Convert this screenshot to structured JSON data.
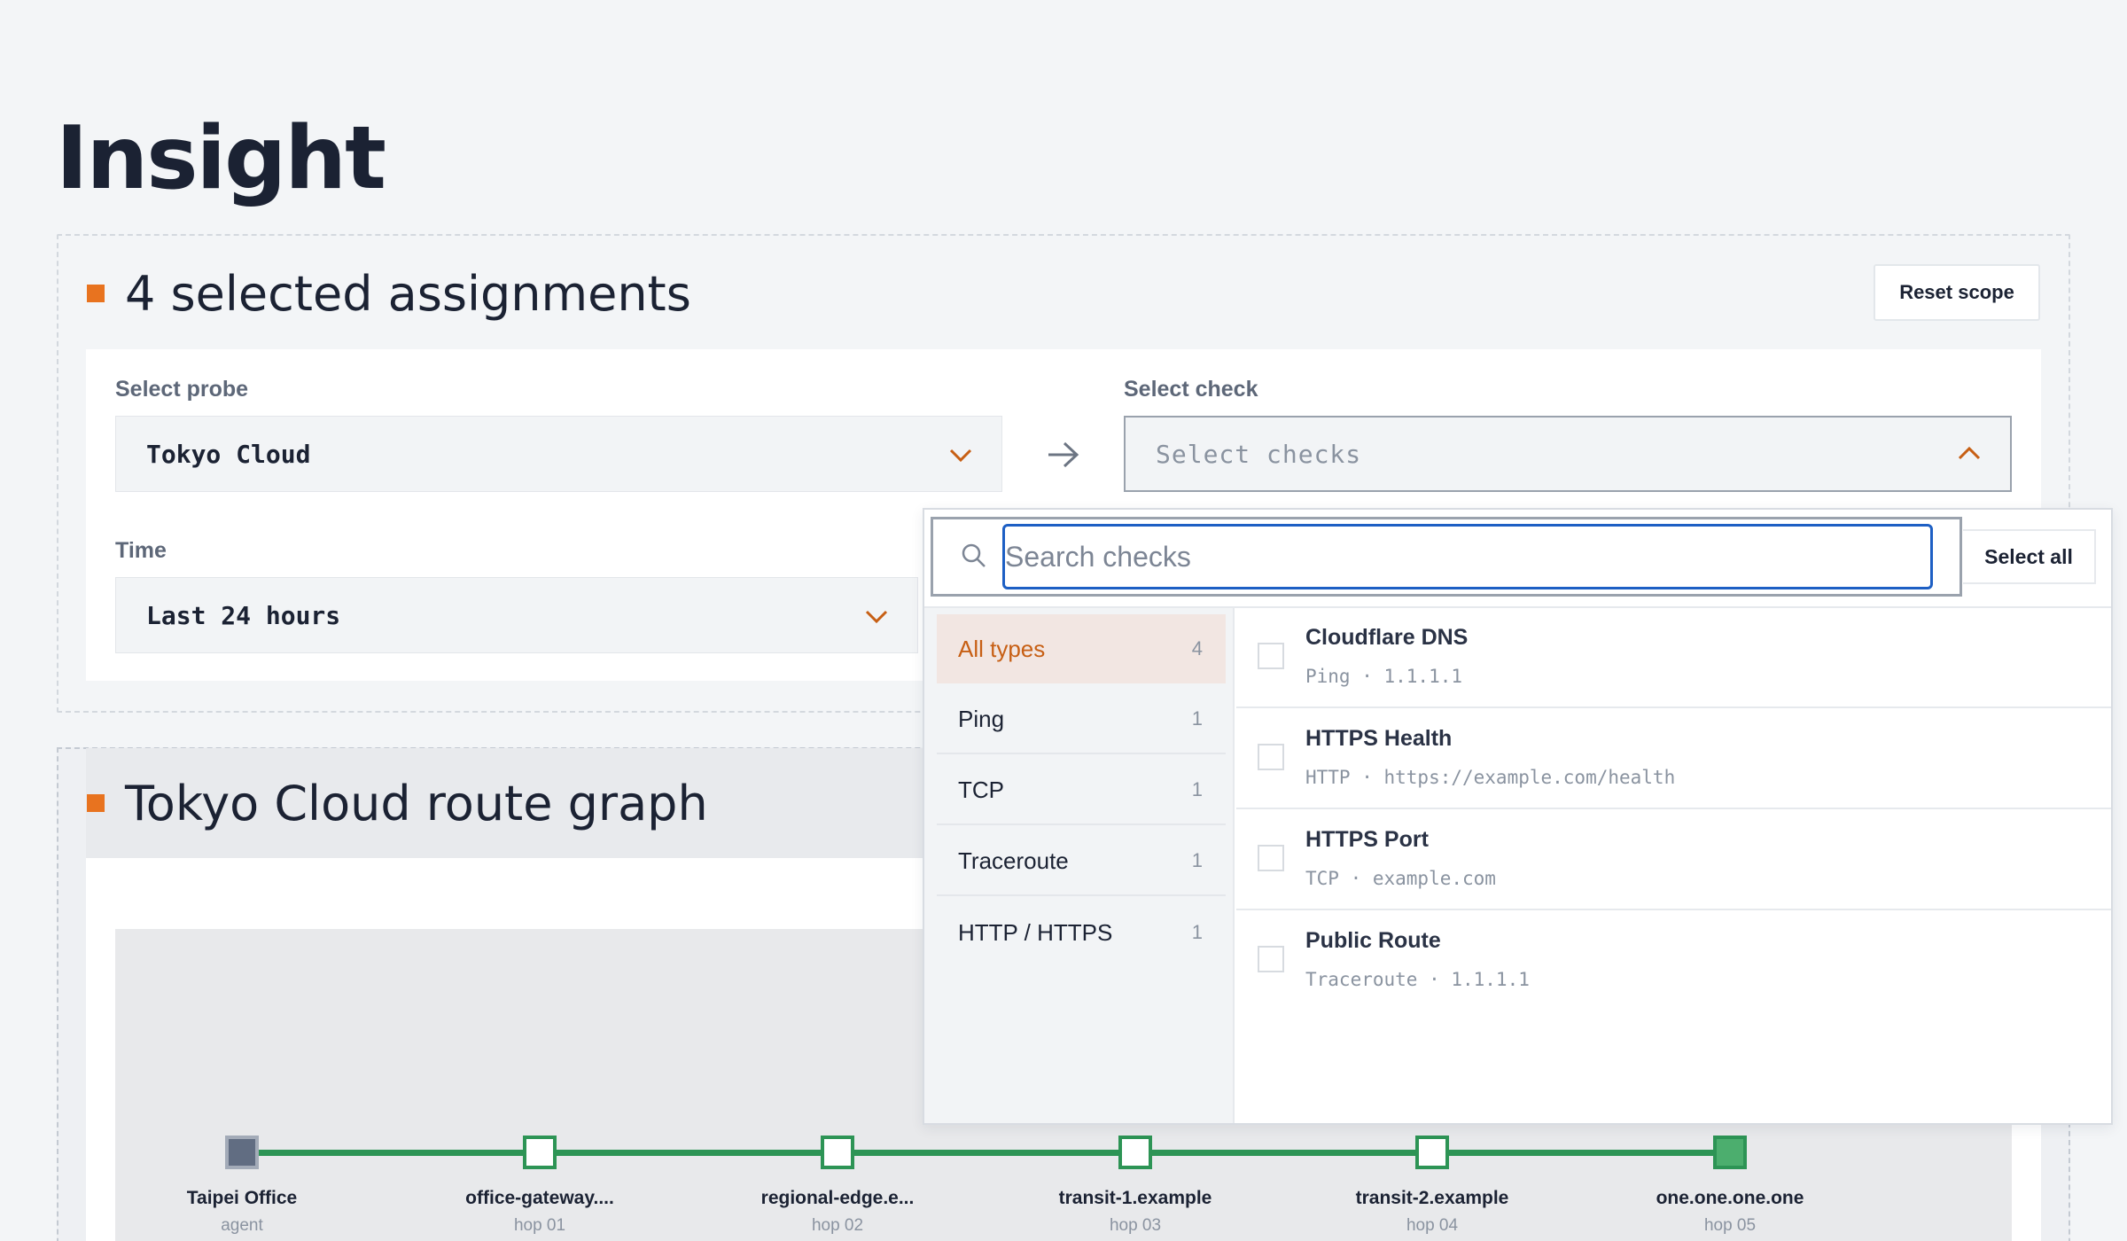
{
  "page": {
    "title": "Insight"
  },
  "assignments": {
    "heading": "4 selected assignments",
    "reset_label": "Reset scope",
    "probe": {
      "label": "Select probe",
      "value": "Tokyo Cloud"
    },
    "check": {
      "label": "Select check",
      "placeholder": "Select checks"
    },
    "time": {
      "label": "Time",
      "value": "Last 24 hours"
    }
  },
  "dropdown": {
    "search_placeholder": "Search checks",
    "select_all_label": "Select all",
    "types": [
      {
        "label": "All types",
        "count": "4",
        "active": true
      },
      {
        "label": "Ping",
        "count": "1"
      },
      {
        "label": "TCP",
        "count": "1"
      },
      {
        "label": "Traceroute",
        "count": "1"
      },
      {
        "label": "HTTP / HTTPS",
        "count": "1"
      }
    ],
    "checks": [
      {
        "name": "Cloudflare DNS",
        "meta": "Ping · 1.1.1.1",
        "checked": false
      },
      {
        "name": "HTTPS Health",
        "meta": "HTTP · https://example.com/health",
        "checked": false
      },
      {
        "name": "HTTPS Port",
        "meta": "TCP · example.com",
        "checked": false
      },
      {
        "name": "Public Route",
        "meta": "Traceroute · 1.1.1.1",
        "checked": false
      }
    ]
  },
  "route_graph": {
    "heading": "Tokyo Cloud route graph",
    "nodes": [
      {
        "label": "Taipei Office",
        "sub": "agent"
      },
      {
        "label": "office-gateway....",
        "sub": "hop 01"
      },
      {
        "label": "regional-edge.e...",
        "sub": "hop 02"
      },
      {
        "label": "transit-1.example",
        "sub": "hop 03"
      },
      {
        "label": "transit-2.example",
        "sub": "hop 04"
      },
      {
        "label": "one.one.one.one",
        "sub": "hop 05"
      }
    ]
  },
  "colors": {
    "accent": "#e8731f",
    "route_green": "#2d9455",
    "focus_blue": "#1d5fc4"
  }
}
